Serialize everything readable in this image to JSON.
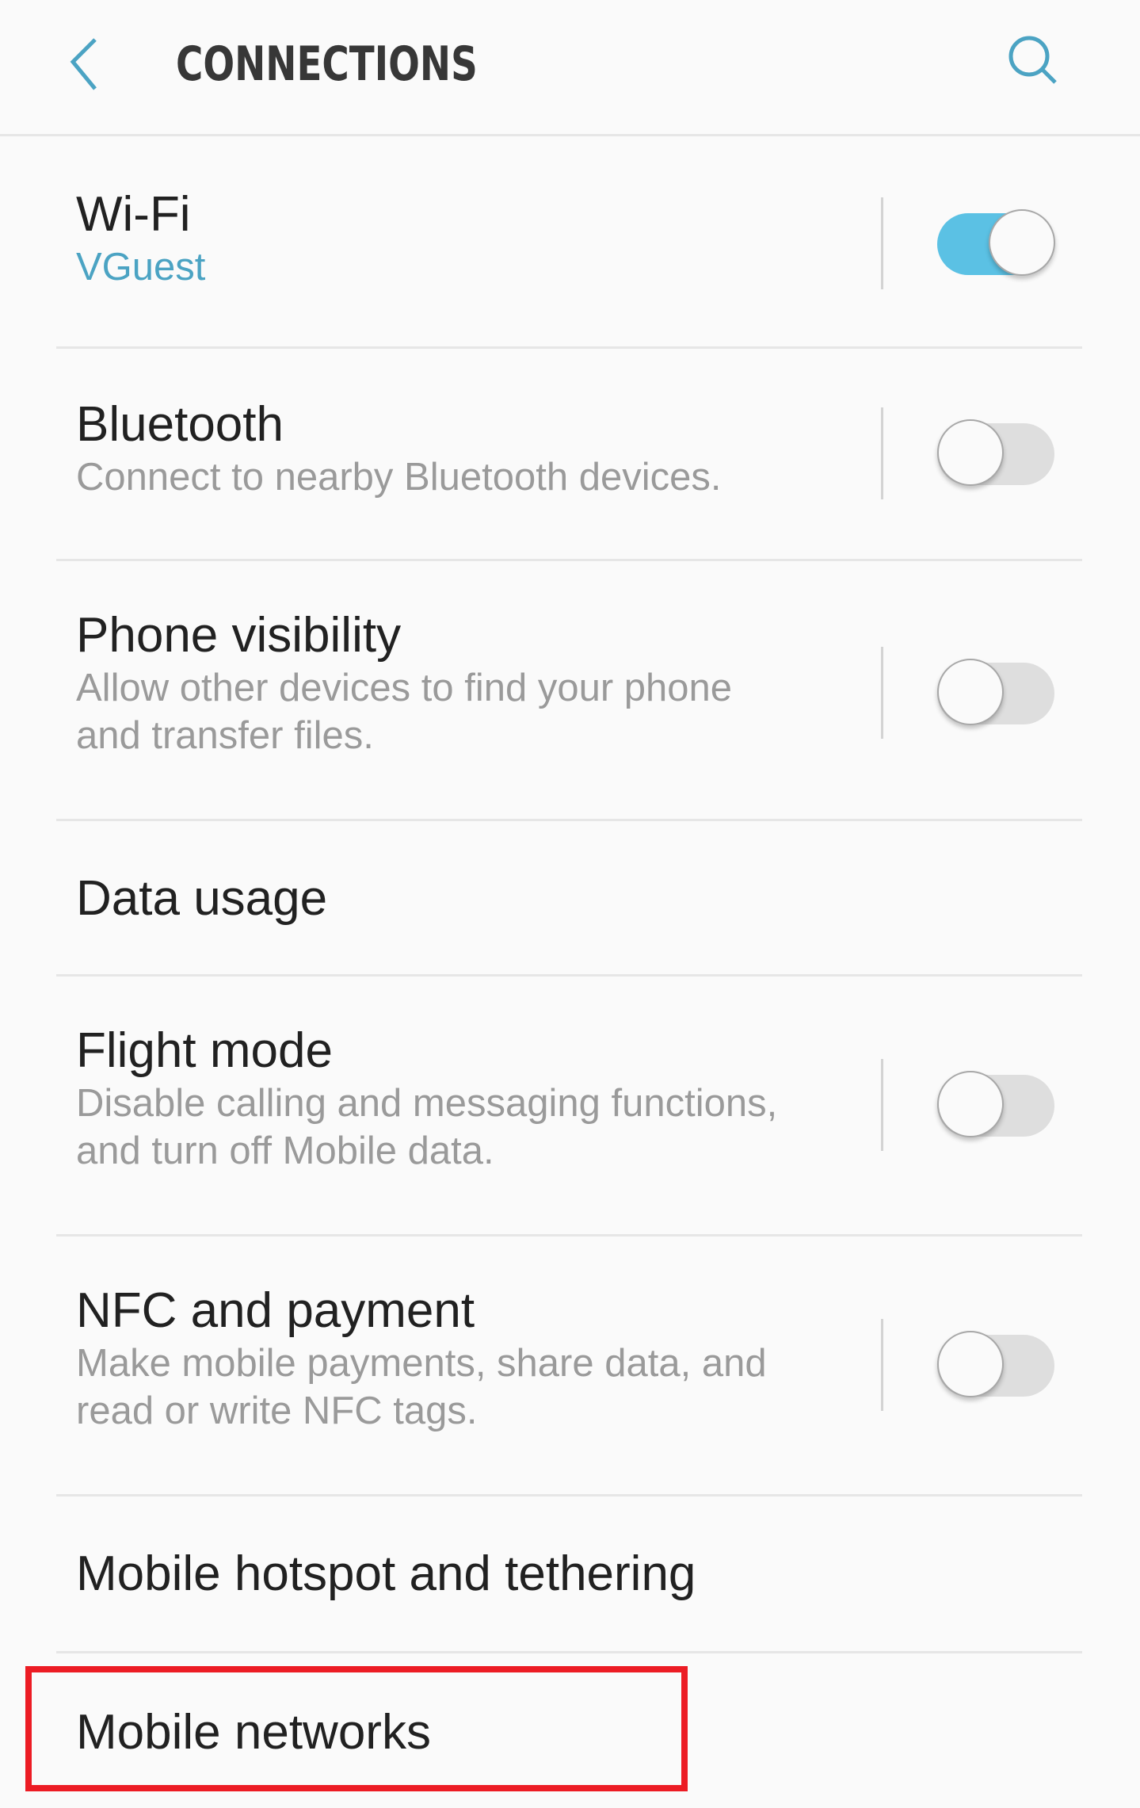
{
  "header": {
    "title": "CONNECTIONS",
    "back_icon": "chevron-left-icon",
    "search_icon": "search-icon",
    "accent_color": "#4BA3C3"
  },
  "items": [
    {
      "title": "Wi-Fi",
      "subtitle": "VGuest",
      "subtitle_accent": true,
      "toggle": true,
      "toggle_on": true
    },
    {
      "title": "Bluetooth",
      "subtitle": "Connect to nearby Bluetooth devices.",
      "toggle": true,
      "toggle_on": false
    },
    {
      "title": "Phone visibility",
      "subtitle_lines": [
        "Allow other devices to find your phone",
        "and transfer files."
      ],
      "toggle": true,
      "toggle_on": false
    },
    {
      "title": "Data usage"
    },
    {
      "title": "Flight mode",
      "subtitle_lines": [
        "Disable calling and messaging functions,",
        "and turn off Mobile data."
      ],
      "toggle": true,
      "toggle_on": false
    },
    {
      "title": "NFC and payment",
      "subtitle_lines": [
        "Make mobile payments, share data, and",
        "read or write NFC tags."
      ],
      "toggle": true,
      "toggle_on": false
    },
    {
      "title": "Mobile hotspot and tethering"
    },
    {
      "title": "Mobile networks",
      "highlighted": true
    }
  ],
  "colors": {
    "toggle_on": "#5BC1E4",
    "toggle_off": "#DEDEDE",
    "highlight": "#EC1C24",
    "title_text": "#212121",
    "subtitle_text": "#9A9A9A"
  }
}
